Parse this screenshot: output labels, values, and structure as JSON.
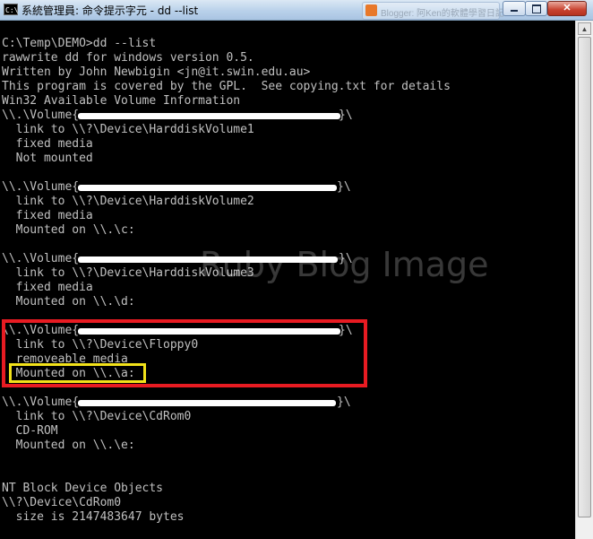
{
  "window": {
    "title": "系統管理員: 命令提示字元 - dd  --list",
    "icon": "cmd-icon",
    "background_tab": "Blogger: 阿Ken的軟體學習日記",
    "controls": {
      "minimize": "minimize-icon",
      "maximize": "maximize-icon",
      "close": "✕"
    }
  },
  "console": {
    "lines": [
      "C:\\Temp\\DEMO>dd --list",
      "rawwrite dd for windows version 0.5.",
      "Written by John Newbigin <jn@it.swin.edu.au>",
      "This program is covered by the GPL.  See copying.txt for details",
      "Win32 Available Volume Information",
      "\\\\.\\Volume{",
      "  link to \\\\?\\Device\\HarddiskVolume1",
      "  fixed media",
      "  Not mounted",
      "",
      "\\\\.\\Volume{",
      "  link to \\\\?\\Device\\HarddiskVolume2",
      "  fixed media",
      "  Mounted on \\\\.\\c:",
      "",
      "\\\\.\\Volume{",
      "  link to \\\\?\\Device\\HarddiskVolume3",
      "  fixed media",
      "  Mounted on \\\\.\\d:",
      "",
      "\\\\.\\Volume{",
      "  link to \\\\?\\Device\\Floppy0",
      "  removeable media",
      "  Mounted on \\\\.\\a:",
      "",
      "\\\\.\\Volume{",
      "  link to \\\\?\\Device\\CdRom0",
      "  CD-ROM",
      "  Mounted on \\\\.\\e:",
      "",
      "",
      "NT Block Device Objects",
      "\\\\?\\Device\\CdRom0",
      "  size is 2147483647 bytes"
    ],
    "volume_close": [
      "}\\",
      "}\\",
      "}\\",
      "}\\",
      "}\\"
    ]
  },
  "annotations": {
    "red_box_color": "#e81b22",
    "yellow_box_color": "#f2e21a"
  },
  "watermark": "Ruby Blog Image"
}
